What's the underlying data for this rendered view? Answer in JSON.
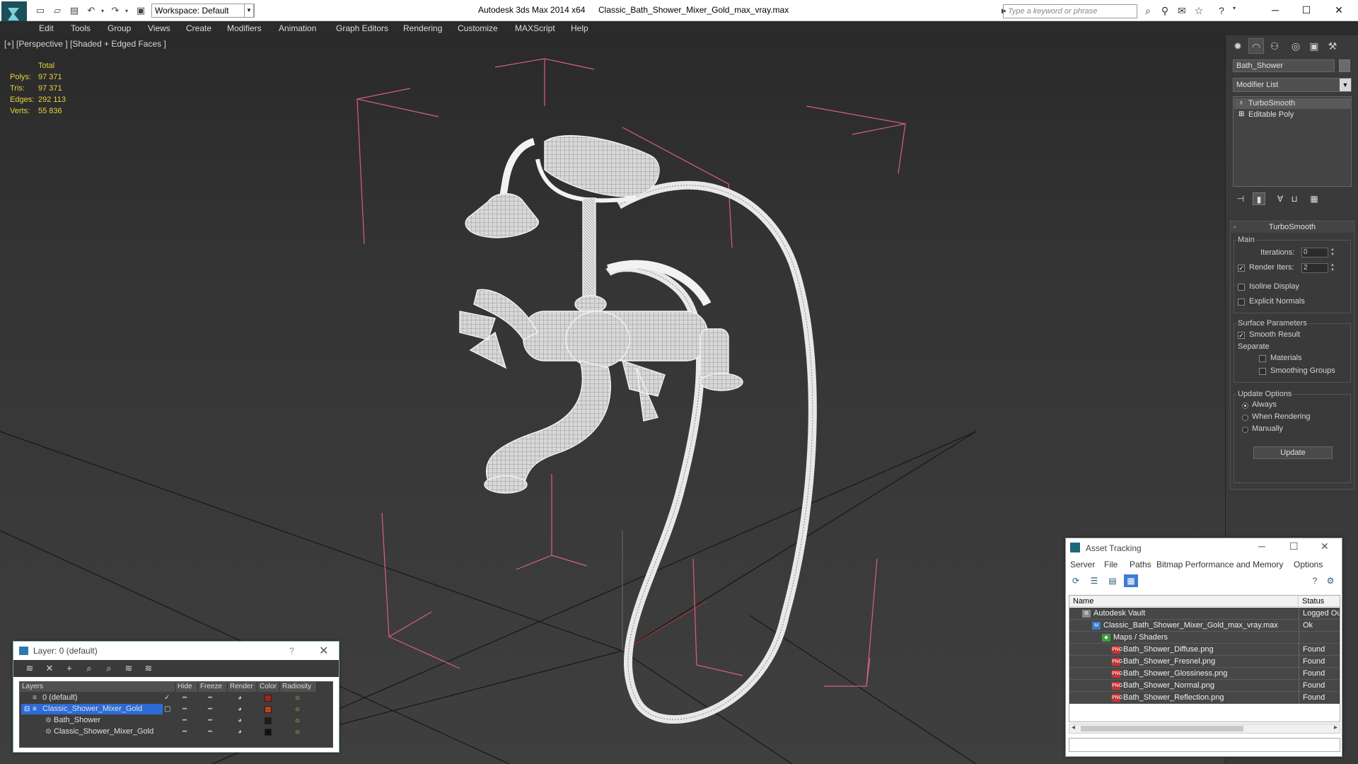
{
  "titlebar": {
    "app_title": "Autodesk 3ds Max  2014 x64",
    "file_name": "Classic_Bath_Shower_Mixer_Gold_max_vray.max",
    "workspace": "Workspace: Default",
    "search_placeholder": "Type a keyword or phrase"
  },
  "menu": [
    "Edit",
    "Tools",
    "Group",
    "Views",
    "Create",
    "Modifiers",
    "Animation",
    "Graph Editors",
    "Rendering",
    "Customize",
    "MAXScript",
    "Help"
  ],
  "viewport": {
    "label": "[+] [Perspective ] [Shaded + Edged Faces ]",
    "stats": {
      "total_label": "Total",
      "rows": [
        {
          "label": "Polys:",
          "value": "97 371"
        },
        {
          "label": "Tris:",
          "value": "97 371"
        },
        {
          "label": "Edges:",
          "value": "292 113"
        },
        {
          "label": "Verts:",
          "value": "55 836"
        }
      ]
    }
  },
  "command_panel": {
    "object_name": "Bath_Shower",
    "modifier_list": "Modifier List",
    "stack": [
      {
        "label": "TurboSmooth",
        "selected": true
      },
      {
        "label": "Editable Poly",
        "selected": false
      }
    ],
    "rollout": {
      "title": "TurboSmooth",
      "main_group": "Main",
      "iterations_label": "Iterations:",
      "iterations_value": "0",
      "render_iters_label": "Render Iters:",
      "render_iters_value": "2",
      "render_iters_checked": true,
      "isoline_label": "Isoline Display",
      "explicit_normals_label": "Explicit Normals",
      "surface_group": "Surface Parameters",
      "smooth_result_label": "Smooth Result",
      "separate_label": "Separate",
      "materials_label": "Materials",
      "smoothing_groups_label": "Smoothing Groups",
      "update_group": "Update Options",
      "always_label": "Always",
      "when_rendering_label": "When Rendering",
      "manually_label": "Manually",
      "update_button": "Update"
    }
  },
  "layer_window": {
    "title": "Layer: 0 (default)",
    "help": "?",
    "columns": [
      "Layers",
      "Hide",
      "Freeze",
      "Render",
      "Color",
      "Radiosity"
    ],
    "rows": [
      {
        "name": "0 (default)",
        "color": "#b31c1c",
        "selected": false,
        "indent": 1,
        "active": true
      },
      {
        "name": "Classic_Shower_Mixer_Gold",
        "color": "#c0401a",
        "selected": true,
        "indent": 1,
        "active": false
      },
      {
        "name": "Bath_Shower",
        "color": "#1c1c1c",
        "selected": false,
        "indent": 2,
        "active": false
      },
      {
        "name": "Classic_Shower_Mixer_Gold",
        "color": "#111111",
        "selected": false,
        "indent": 2,
        "active": false
      }
    ]
  },
  "asset_tracking": {
    "title": "Asset Tracking",
    "menu": [
      "Server",
      "File",
      "Paths",
      "Bitmap Performance and Memory",
      "Options"
    ],
    "columns": [
      "Name",
      "Status"
    ],
    "rows": [
      {
        "name": "Autodesk Vault",
        "status": "Logged Ou",
        "indent": 0,
        "icon": "vault"
      },
      {
        "name": "Classic_Bath_Shower_Mixer_Gold_max_vray.max",
        "status": "Ok",
        "indent": 1,
        "icon": "max"
      },
      {
        "name": "Maps / Shaders",
        "status": "",
        "indent": 2,
        "icon": "maps"
      },
      {
        "name": "Bath_Shower_Diffuse.png",
        "status": "Found",
        "indent": 3,
        "icon": "png"
      },
      {
        "name": "Bath_Shower_Fresnel.png",
        "status": "Found",
        "indent": 3,
        "icon": "png"
      },
      {
        "name": "Bath_Shower_Glossiness.png",
        "status": "Found",
        "indent": 3,
        "icon": "png"
      },
      {
        "name": "Bath_Shower_Normal.png",
        "status": "Found",
        "indent": 3,
        "icon": "png"
      },
      {
        "name": "Bath_Shower_Reflection.png",
        "status": "Found",
        "indent": 3,
        "icon": "png"
      }
    ]
  },
  "colors": {
    "stats_text": "#e7d33b",
    "bbox_lines": "#d8607a",
    "selection_blue": "#2d6bd6",
    "wire": "#f2f2f2"
  }
}
